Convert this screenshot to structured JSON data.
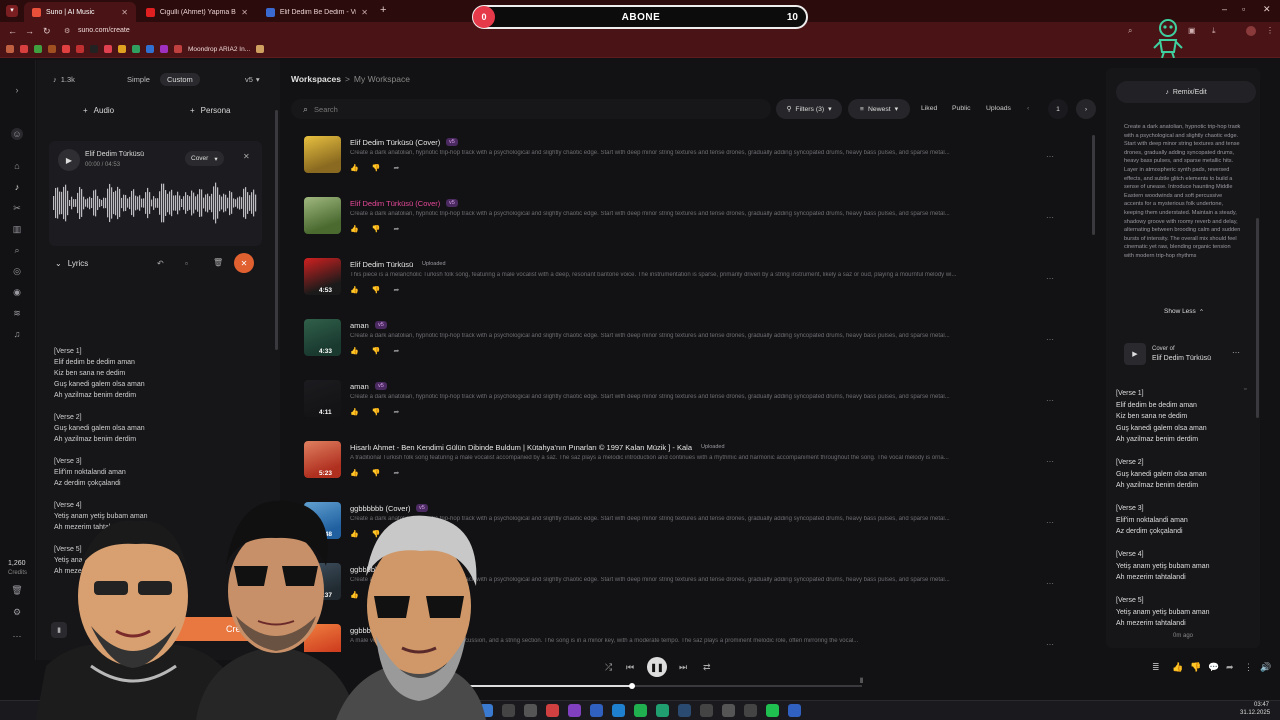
{
  "browser": {
    "tabs": [
      {
        "title": "Suno | AI Music",
        "active": true
      },
      {
        "title": "Cigulli (Ahmet) Yapma Bana Nu"
      },
      {
        "title": "Elif Dedim Be Dedim - Vikikayn"
      }
    ],
    "url": "suno.com/create",
    "bookmark_item": "Moondrop ARIA2 In..."
  },
  "sub_banner": {
    "left": "0",
    "center": "ABONE",
    "right": "10"
  },
  "create_panel": {
    "credit_count": "1.3k",
    "mode_simple": "Simple",
    "mode_custom": "Custom",
    "version": "v5",
    "audio_label": "Audio",
    "persona_label": "Persona",
    "track_title": "Elif Dedim Türküsü",
    "track_time": "00:00 / 04:53",
    "cover_label": "Cover",
    "lyrics_label": "Lyrics",
    "create_label": "Create",
    "credits_value": "1,260",
    "credits_label": "Credits",
    "lyrics": [
      {
        "tag": "[Verse 1]",
        "lines": [
          "Elif dedim be dedim aman",
          "Kiz ben sana ne dedim",
          "Guş kanedi galem olsa aman",
          "Ah yazilmaz benim derdim"
        ]
      },
      {
        "tag": "[Verse 2]",
        "lines": [
          "Guş kanedi galem olsa aman",
          "Ah yazilmaz benim derdim"
        ]
      },
      {
        "tag": "[Verse 3]",
        "lines": [
          "Elif'im noktalandi aman",
          "Az derdim çokçalandi"
        ]
      },
      {
        "tag": "[Verse 4]",
        "lines": [
          "Yetiş anam yetiş bubam aman",
          "Ah mezerim tahtalandi"
        ]
      },
      {
        "tag": "[Verse 5]",
        "lines": [
          "Yetiş anam yetiş bubam aman",
          "Ah mezerim tahtalandi"
        ]
      }
    ]
  },
  "workspace": {
    "crumb_root": "Workspaces",
    "crumb_sep": ">",
    "crumb_current": "My Workspace",
    "search_placeholder": "Search",
    "filters_label": "Filters (3)",
    "sort_label": "Newest",
    "liked": "Liked",
    "public": "Public",
    "uploads": "Uploads",
    "page": "1",
    "songs": [
      {
        "title": "Elif Dedim Türküsü (Cover)",
        "badge": "v5",
        "duration": "",
        "desc": "Create a dark anatolian, hypnotic trip-hop track with a psychological and slightly chaotic edge. Start with deep minor string textures and tense drones, gradually adding syncopated drums, heavy bass pulses, and sparse metal...",
        "pink": false,
        "colors": [
          "#8a6a20",
          "#e8c040"
        ]
      },
      {
        "title": "Elif Dedim Türküsü (Cover)",
        "badge": "v5",
        "duration": "",
        "desc": "Create a dark anatolian, hypnotic trip-hop track with a psychological and slightly chaotic edge. Start with deep minor string textures and tense drones, gradually adding syncopated drums, heavy bass pulses, and sparse metal...",
        "pink": true,
        "colors": [
          "#4a6a30",
          "#a0b880"
        ]
      },
      {
        "title": "Elif Dedim Türküsü",
        "badge": "Uploaded",
        "duration": "4:53",
        "desc": "This piece is a melancholic Turkish folk song, featuring a male vocalist with a deep, resonant baritone voice. The instrumentation is sparse, primarily driven by a string instrument, likely a saz or oud, playing a mournful melody wi...",
        "pink": false,
        "colors": [
          "#1a1a1a",
          "#d02020"
        ]
      },
      {
        "title": "aman",
        "badge": "v5",
        "duration": "4:33",
        "desc": "Create a dark anatolian, hypnotic trip-hop track with a psychological and slightly chaotic edge. Start with deep minor string textures and tense drones, gradually adding syncopated drums, heavy bass pulses, and sparse metal...",
        "pink": false,
        "colors": [
          "#1a3a30",
          "#30604a"
        ]
      },
      {
        "title": "aman",
        "badge": "v5",
        "duration": "4:11",
        "desc": "Create a dark anatolian, hypnotic trip-hop track with a psychological and slightly chaotic edge. Start with deep minor string textures and tense drones, gradually adding syncopated drums, heavy bass pulses, and sparse metal...",
        "pink": false,
        "colors": [
          "#141416",
          "#1c1c20"
        ]
      },
      {
        "title": "Hisarlı Ahmet - Ben Kendimi Gülün Dibinde Buldum | Kütahya'nın Pınarları © 1997 Kalan Müzik ] - Kala",
        "badge": "Uploaded",
        "duration": "5:23",
        "desc": "A traditional Turkish folk song featuring a male vocalist accompanied by a saz. The saz plays a melodic introduction and continues with a rhythmic and harmonic accompaniment throughout the song. The vocal melody is orna...",
        "pink": false,
        "colors": [
          "#b03020",
          "#e08060"
        ]
      },
      {
        "title": "ggbbbbbb (Cover)",
        "badge": "v5",
        "duration": "3:48",
        "desc": "Create a dark anatolian, hypnotic trip-hop track with a psychological and slightly chaotic edge. Start with deep minor string textures and tense drones, gradually adding syncopated drums, heavy bass pulses, and sparse metal...",
        "pink": false,
        "colors": [
          "#2060a0",
          "#60a0d0"
        ]
      },
      {
        "title": "ggbbbbbb",
        "badge": "",
        "duration": "3:37",
        "desc": "Create a dark anatolian, hypnotic trip-hop track with a psychological and slightly chaotic edge. Start with deep minor string textures and tense drones, gradually adding syncopated drums, heavy bass pulses, and sparse metal...",
        "pink": false,
        "colors": [
          "#202a30",
          "#405060"
        ]
      },
      {
        "title": "ggbbbbbb",
        "badge": "",
        "duration": "",
        "desc": "A male vocalist, accompanied by a saz, percussion, and a string section. The song is in a minor key, with a moderate tempo. The saz plays a prominent melodic role, often mirroring the vocal...",
        "pink": false,
        "colors": [
          "#d04020",
          "#f08040"
        ]
      }
    ]
  },
  "right_panel": {
    "remix_label": "Remix/Edit",
    "prompt": "Create a dark anatolian, hypnotic trip-hop track with a psychological and slightly chaotic edge. Start with deep minor string textures and tense drones, gradually adding syncopated drums, heavy bass pulses, and sparse metallic hits. Layer in atmospheric synth pads, reversed effects, and subtle glitch elements to build a sense of unease. Introduce haunting Middle Eastern woodwinds and soft percussive accents for a mysterious folk undertone, keeping them understated. Maintain a steady, shadowy groove with roomy reverb and delay, alternating between brooding calm and sudden bursts of intensity. The overall mix should feel cinematic yet raw, blending organic tension with modern trip-hop rhythms",
    "show_less": "Show Less",
    "cover_of_label": "Cover of",
    "cover_of_title": "Elif Dedim Türküsü",
    "ago": "0m ago"
  },
  "taskbar": {
    "time": "03:47",
    "date": "31.12.2025"
  }
}
